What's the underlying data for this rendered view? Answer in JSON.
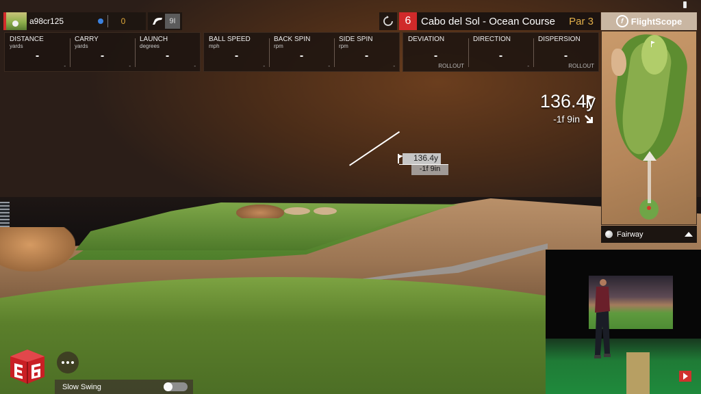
{
  "player": {
    "name": "a98cr125",
    "score": "0",
    "status_color": "#3b82e0",
    "accent_color": "#d22b2b"
  },
  "club": {
    "icon": "iron-club-icon",
    "label": "9I"
  },
  "hole": {
    "number": "6",
    "course": "Cabo del Sol - Ocean Course",
    "par": "Par 3",
    "number_color": "#d02a2a",
    "par_color": "#e3b04a"
  },
  "brand": {
    "name": "FlightScope"
  },
  "stats": {
    "group1": [
      {
        "label": "DISTANCE",
        "unit": "yards",
        "value": "-",
        "sub": "-"
      },
      {
        "label": "CARRY",
        "unit": "yards",
        "value": "-",
        "sub": "-"
      },
      {
        "label": "LAUNCH",
        "unit": "degrees",
        "value": "-",
        "sub": "-"
      }
    ],
    "group2": [
      {
        "label": "BALL SPEED",
        "unit": "mph",
        "value": "-",
        "sub": "-"
      },
      {
        "label": "BACK SPIN",
        "unit": "rpm",
        "value": "-",
        "sub": "-"
      },
      {
        "label": "SIDE SPIN",
        "unit": "rpm",
        "value": "-",
        "sub": "-"
      }
    ],
    "group3": [
      {
        "label": "DEVIATION",
        "unit": "",
        "value": "-",
        "sub": "ROLLOUT"
      },
      {
        "label": "DIRECTION",
        "unit": "",
        "value": "-",
        "sub": "-"
      },
      {
        "label": "DISPERSION",
        "unit": "",
        "value": "-",
        "sub": "ROLLOUT"
      }
    ]
  },
  "target": {
    "distance": "136.4y",
    "elevation": "-1f 9in",
    "flag_icon": "flag-icon",
    "elevation_icon": "arrow-down-right-icon"
  },
  "aim_tag": {
    "distance": "136.4y",
    "elevation": "-1f 9in"
  },
  "map": {
    "lie": "Fairway",
    "toggle_icon": "triangle-up-icon"
  },
  "controls": {
    "more_icon": "ellipsis-icon",
    "slow_swing_label": "Slow Swing",
    "slow_swing_on": false
  },
  "logo": {
    "text": "E6"
  }
}
